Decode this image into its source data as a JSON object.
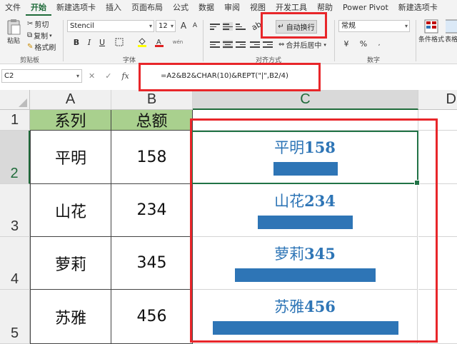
{
  "ribbon_tabs": [
    "文件",
    "开始",
    "新建选项卡",
    "插入",
    "页面布局",
    "公式",
    "数据",
    "审阅",
    "视图",
    "开发工具",
    "帮助",
    "Power Pivot",
    "新建选项卡"
  ],
  "clipboard": {
    "paste": "粘贴",
    "cut": "剪切",
    "copy": "复制",
    "format_painter": "格式刷",
    "group": "剪贴板"
  },
  "font": {
    "name": "Stencil",
    "size": "12",
    "group": "字体",
    "bold": "B",
    "italic": "I",
    "underline": "U",
    "grow": "A",
    "shrink": "A",
    "color_letter": "A",
    "phonetic": "wén"
  },
  "alignment": {
    "wrap_text": "自动换行",
    "merge_center": "合并后居中",
    "group": "对齐方式"
  },
  "number": {
    "format": "常规",
    "group": "数字",
    "currency": "¥",
    "percent": "%"
  },
  "styles": {
    "conditional_format": "条件格式",
    "table_format": "套用表格格式"
  },
  "formula_bar": {
    "cell_ref": "C2",
    "cancel": "✕",
    "enter": "✓",
    "fx": "fx",
    "formula": "=A2&B2&CHAR(10)&REPT(\"|\",B2/4)"
  },
  "columns": [
    "A",
    "B",
    "C",
    "D"
  ],
  "rows": [
    "1",
    "2",
    "3",
    "4",
    "5"
  ],
  "table": {
    "header_series": "系列",
    "header_total": "总额",
    "records": [
      {
        "series": "平明",
        "total": "158",
        "value": 158
      },
      {
        "series": "山花",
        "total": "234",
        "value": 234
      },
      {
        "series": "萝莉",
        "total": "345",
        "value": 345
      },
      {
        "series": "苏雅",
        "total": "456",
        "value": 456
      }
    ]
  },
  "colors": {
    "header_fill": "#a9d08e",
    "bar_color": "#2e75b6",
    "highlight": "#e8262a",
    "accent": "#1f6b3a"
  }
}
